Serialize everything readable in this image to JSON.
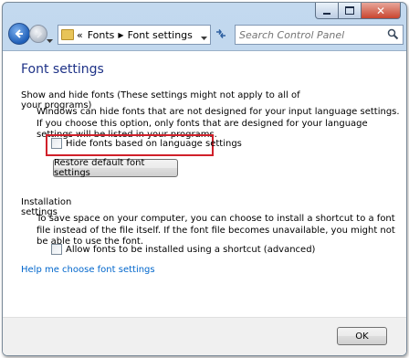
{
  "nav": {
    "path": [
      "Fonts",
      "Font settings"
    ],
    "search_placeholder": "Search Control Panel"
  },
  "page": {
    "title": "Font settings",
    "show_hide": {
      "heading": "Show and hide fonts (These settings might not apply to all of your programs)",
      "description": "Windows can hide fonts that are not designed for your input language settings. If you choose this option, only fonts that are designed for your language settings will be listed in your programs.",
      "checkbox_label": "Hide fonts based on language settings",
      "checkbox_checked": false,
      "restore_button": "Restore default font settings"
    },
    "installation": {
      "heading": "Installation settings",
      "description": "To save space on your computer, you can choose to install a shortcut to a font file instead of the file itself. If the font file becomes unavailable, you might not be able to use the font.",
      "checkbox_label": "Allow fonts to be installed using a shortcut (advanced)",
      "checkbox_checked": false
    },
    "help_link": "Help me choose font settings",
    "ok_button": "OK"
  },
  "colors": {
    "title_blue": "#1e3287",
    "link_blue": "#0066cc",
    "highlight_red": "#d0202a"
  }
}
